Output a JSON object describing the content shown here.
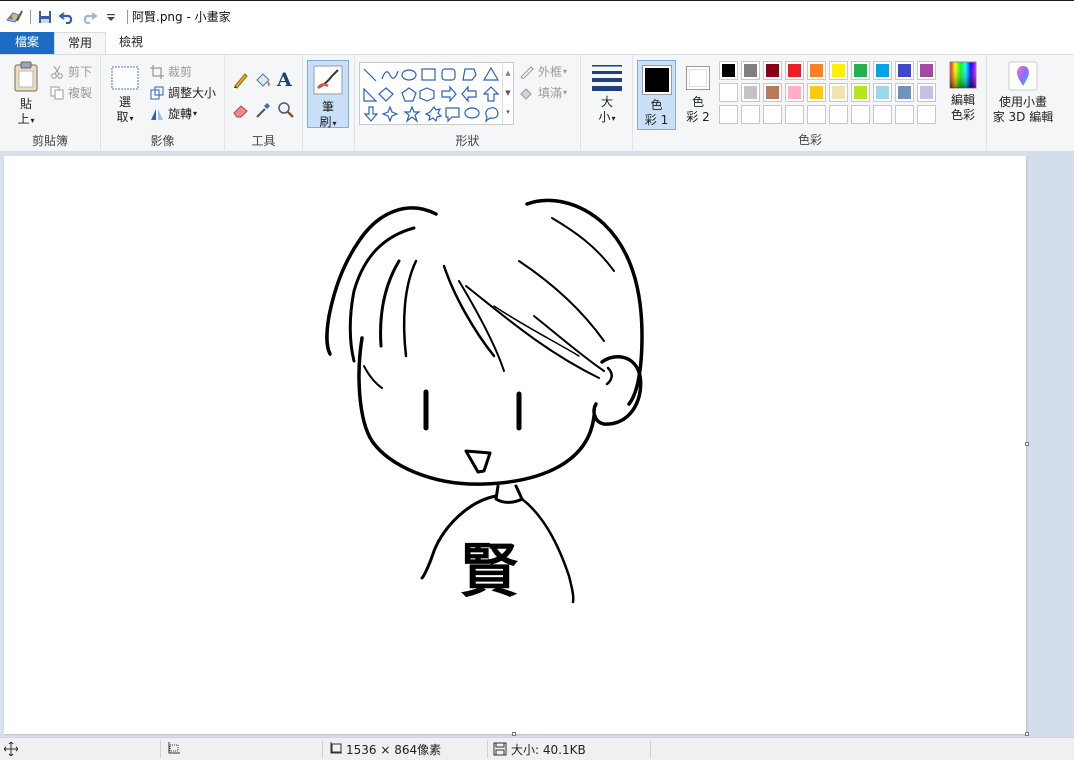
{
  "titlebar": {
    "title": "阿賢.png - 小畫家",
    "icons": [
      "paint-app-icon",
      "save-icon",
      "undo-icon",
      "redo-icon",
      "customize-quick-access-icon"
    ]
  },
  "tabs": [
    {
      "label": "檔案",
      "active": false
    },
    {
      "label": "常用",
      "active": true
    },
    {
      "label": "檢視",
      "active": false
    }
  ],
  "ribbon": {
    "clipboard": {
      "group_label": "剪貼簿",
      "paste_top": "貼",
      "paste_bottom": "上",
      "cut": "剪下",
      "copy": "複製"
    },
    "image": {
      "group_label": "影像",
      "select_top": "選",
      "select_bottom": "取",
      "crop": "裁剪",
      "resize": "調整大小",
      "rotate": "旋轉"
    },
    "tools": {
      "group_label": "工具",
      "text_glyph": "A"
    },
    "brushes": {
      "top": "筆",
      "bottom": "刷"
    },
    "shapes": {
      "group_label": "形狀",
      "outline": "外框",
      "fill": "填滿"
    },
    "size": {
      "top": "大",
      "bottom": "小"
    },
    "colors": {
      "group_label": "色彩",
      "color1_top": "色",
      "color1_bottom": "彩 1",
      "color2_top": "色",
      "color2_bottom": "彩 2",
      "color1_value": "#000000",
      "color2_value": "#ffffff",
      "edit_top": "編輯",
      "edit_bottom": "色彩",
      "paint3d_top": "使用小畫",
      "paint3d_bottom": "家 3D 編輯",
      "palette_row1": [
        "#000000",
        "#7f7f7f",
        "#880015",
        "#ed1c24",
        "#ff7f27",
        "#fff200",
        "#22b14c",
        "#00a2e8",
        "#3f48cc",
        "#a349a4"
      ],
      "palette_row2": [
        "#ffffff",
        "#c3c3c3",
        "#b97a57",
        "#ffaec9",
        "#ffc90e",
        "#efe4b0",
        "#b5e61d",
        "#99d9ea",
        "#7092be",
        "#c8bfe7"
      ],
      "palette_row3": [
        "",
        "",
        "",
        "",
        "",
        "",
        "",
        "",
        "",
        ""
      ]
    }
  },
  "canvas": {
    "drawing_text": "賢"
  },
  "status": {
    "dimensions": "1536 × 864像素",
    "size": "大小: 40.1KB"
  }
}
